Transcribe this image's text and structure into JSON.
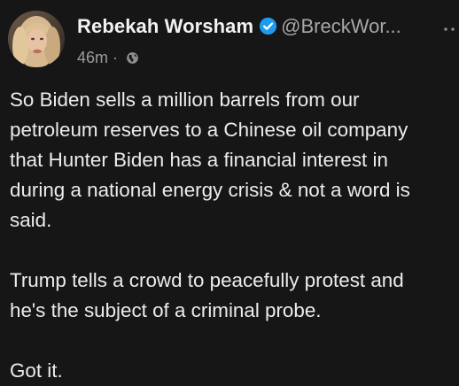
{
  "post": {
    "author": {
      "name": "Rebekah Worsham",
      "handle": "@BreckWor...",
      "verified_icon": "verified-badge",
      "verified_color": "#1d9bf0"
    },
    "time": "46m",
    "separator": "·",
    "visibility_icon": "globe-icon",
    "paragraphs": [
      "So Biden sells a million barrels from our\npetroleum reserves to a Chinese oil company\nthat Hunter Biden has a financial interest in\nduring a national energy crisis & not a word is\nsaid.",
      "Trump tells a crowd to peacefully protest and\nhe's the subject of a criminal probe.",
      "Got it."
    ]
  },
  "theme": {
    "background": "#161616",
    "text": "#ececec",
    "secondary_text": "#9b9b9b"
  }
}
